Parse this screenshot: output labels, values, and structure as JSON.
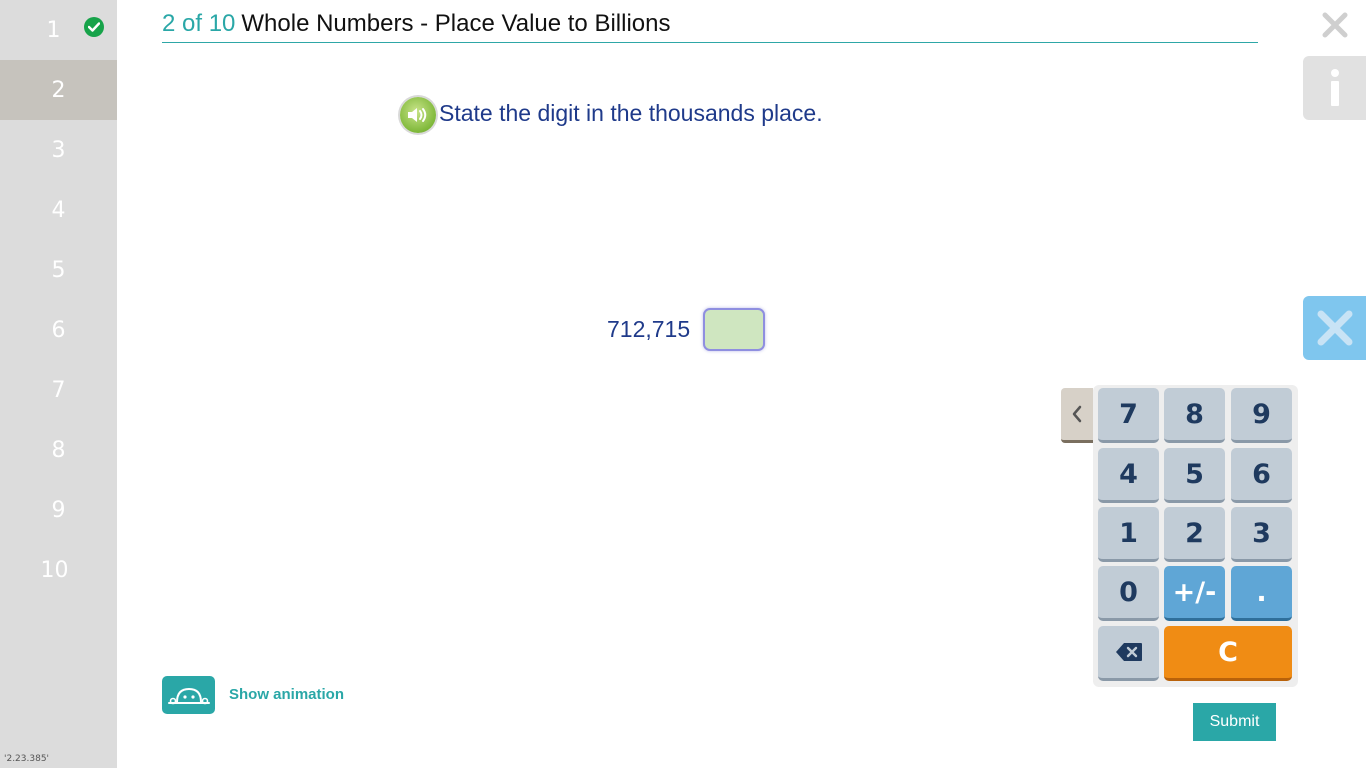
{
  "sidebar": {
    "items": [
      {
        "label": "1",
        "completed": true
      },
      {
        "label": "2",
        "active": true
      },
      {
        "label": "3"
      },
      {
        "label": "4"
      },
      {
        "label": "5"
      },
      {
        "label": "6"
      },
      {
        "label": "7"
      },
      {
        "label": "8"
      },
      {
        "label": "9"
      },
      {
        "label": "10"
      }
    ],
    "version": "'2.23.385'"
  },
  "header": {
    "counter": "2 of 10",
    "title": "Whole Numbers - Place Value to Billions"
  },
  "question": {
    "prompt": "State the digit in the thousands place.",
    "number": "712,715",
    "answer": ""
  },
  "keypad": {
    "keys": [
      "7",
      "8",
      "9",
      "4",
      "5",
      "6",
      "1",
      "2",
      "3",
      "0",
      "+/-",
      ".",
      "C"
    ]
  },
  "footer": {
    "show_animation_label": "Show animation",
    "submit_label": "Submit"
  },
  "colors": {
    "accent": "#2aa7a7",
    "text_blue": "#1f3a8a",
    "completed_green": "#17a34a",
    "key_orange": "#f08c14",
    "key_blue": "#5fa6d6",
    "answer_box": "#cfe6c0"
  }
}
